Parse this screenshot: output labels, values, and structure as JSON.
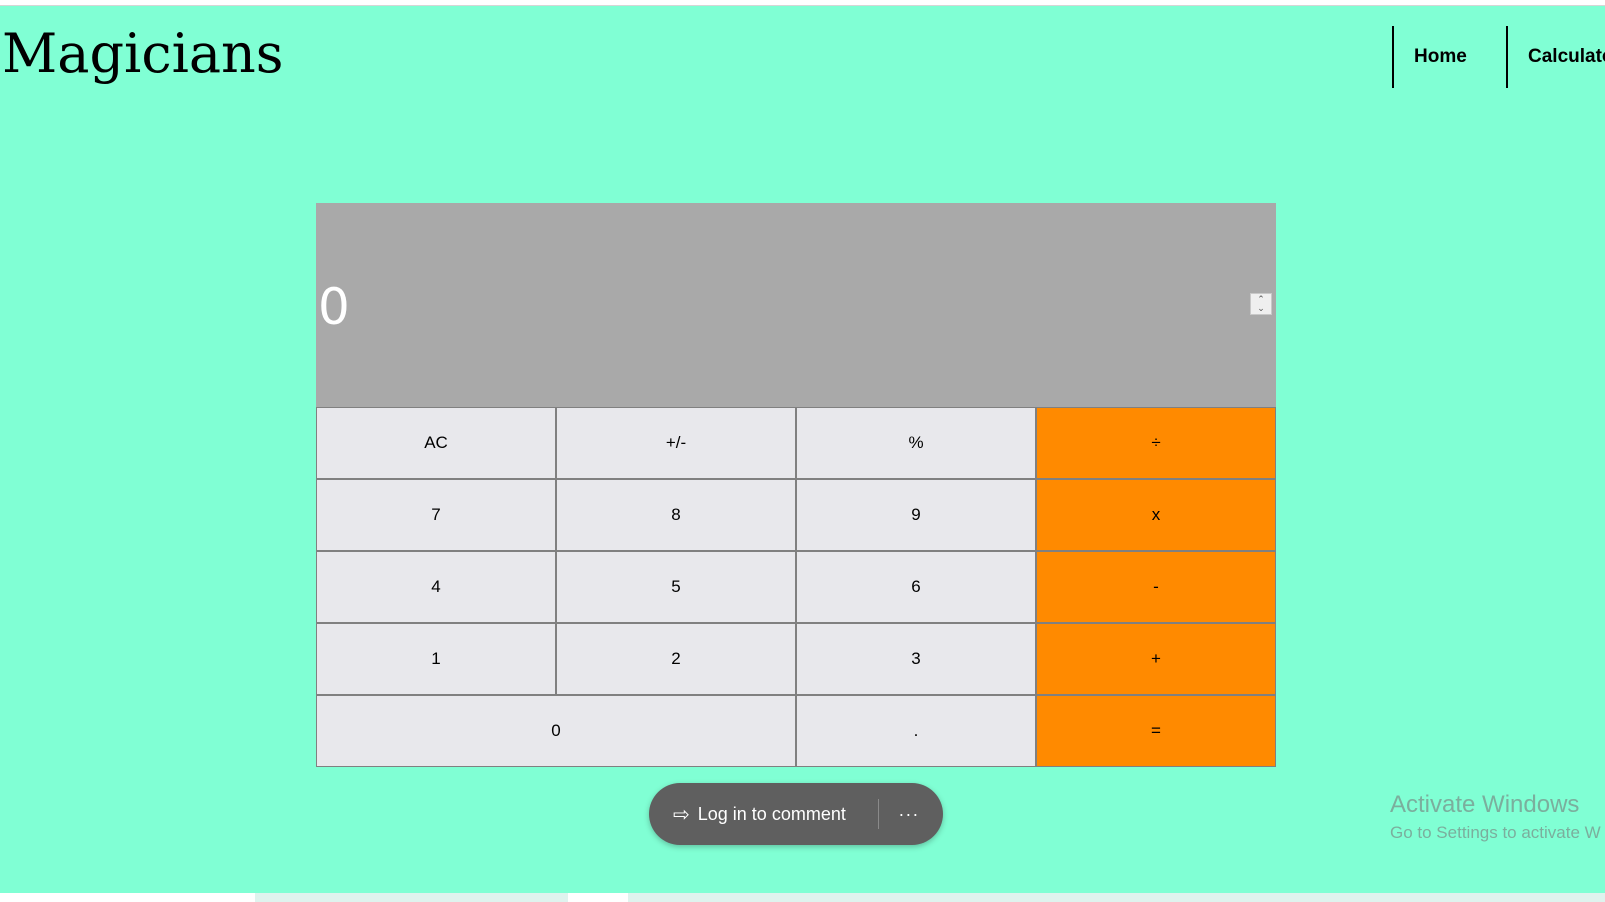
{
  "header": {
    "brand": "Magicians",
    "nav": [
      "Home",
      "Calculato"
    ]
  },
  "display": {
    "value": "0"
  },
  "keys": {
    "row1": [
      "AC",
      "+/-",
      "%",
      "÷"
    ],
    "row2": [
      "7",
      "8",
      "9",
      "x"
    ],
    "row3": [
      "4",
      "5",
      "6",
      "-"
    ],
    "row4": [
      "1",
      "2",
      "3",
      "+"
    ],
    "row5": [
      "0",
      ".",
      "="
    ]
  },
  "comment_bar": {
    "login_label": "Log in to comment",
    "more_label": "···",
    "login_icon": "sign-in-icon",
    "more_icon": "more-icon"
  },
  "watermark": {
    "title": "Activate Windows",
    "subtitle": "Go to Settings to activate W"
  },
  "colors": {
    "background": "#80ffd4",
    "display_bg": "#a9a9a9",
    "operator": "#ff8a00",
    "key": "#e8e8ec"
  }
}
